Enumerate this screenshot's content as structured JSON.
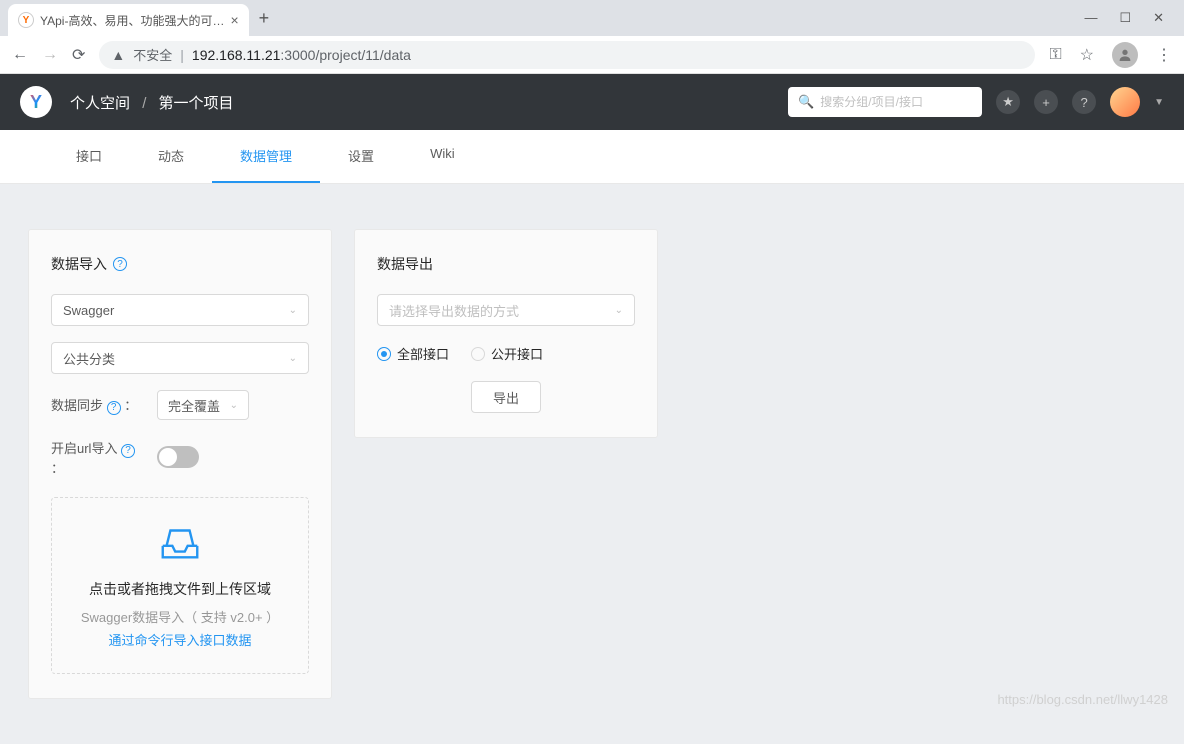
{
  "browser": {
    "tab_title": "YApi-高效、易用、功能强大的可…",
    "url_insecure_label": "不安全",
    "url_host": "192.168.11.21",
    "url_port_path": ":3000/project/11/data"
  },
  "header": {
    "breadcrumb_workspace": "个人空间",
    "breadcrumb_project": "第一个项目",
    "search_placeholder": "搜索分组/项目/接口"
  },
  "tabs": {
    "items": [
      "接口",
      "动态",
      "数据管理",
      "设置",
      "Wiki"
    ],
    "active_index": 2
  },
  "import_card": {
    "title": "数据导入",
    "format_select": "Swagger",
    "category_select": "公共分类",
    "sync_label": "数据同步",
    "sync_colon": "：",
    "sync_mode": "完全覆盖",
    "url_import_label": "开启url导入",
    "url_import_colon": "：",
    "upload_text": "点击或者拖拽文件到上传区域",
    "upload_hint": "Swagger数据导入（ 支持 v2.0+ ）",
    "upload_link": "通过命令行导入接口数据"
  },
  "export_card": {
    "title": "数据导出",
    "format_placeholder": "请选择导出数据的方式",
    "radio_all": "全部接口",
    "radio_public": "公开接口",
    "export_btn": "导出"
  },
  "watermark": "https://blog.csdn.net/llwy1428"
}
